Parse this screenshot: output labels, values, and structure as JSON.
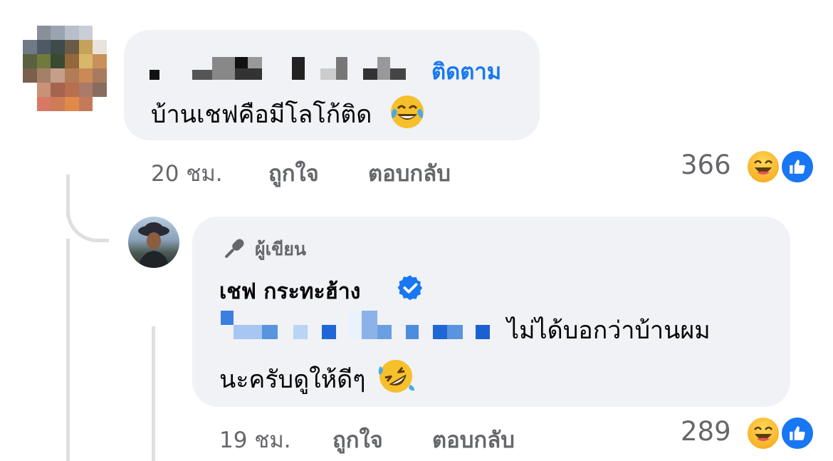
{
  "comment1": {
    "follow_label": "ติดตาม",
    "text": "บ้านเชฟคือมีโลโก้ติด",
    "time": "20 ชม.",
    "like_label": "ถูกใจ",
    "reply_label": "ตอบกลับ",
    "reaction_count": "366",
    "reactions": [
      "haha-icon",
      "like-icon"
    ]
  },
  "reply": {
    "author_badge": "ผู้เขียน",
    "name": "เชฟ กระทะฮ้าง",
    "text_line1": "ไม่ได้บอกว่าบ้านผม",
    "text_line2": "นะครับดูให้ดีๆ",
    "time": "19 ชม.",
    "like_label": "ถูกใจ",
    "reply_label": "ตอบกลับ",
    "reaction_count": "289",
    "reactions": [
      "haha-icon",
      "like-icon"
    ]
  },
  "colors": {
    "accent": "#1877f2",
    "bubble": "#f0f2f5",
    "meta": "#65676b",
    "reaction_yellow": "#f7b125"
  }
}
